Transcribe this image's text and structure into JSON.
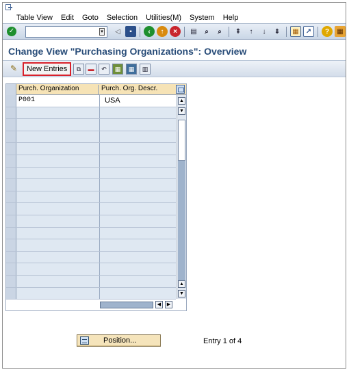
{
  "menu": {
    "items": [
      "Table View",
      "Edit",
      "Goto",
      "Selection",
      "Utilities(M)",
      "System",
      "Help"
    ]
  },
  "toolbar": {
    "command_value": "",
    "icons": [
      "enter-icon",
      "save-icon",
      "back-icon",
      "exit-icon",
      "cancel-icon",
      "print-icon",
      "find-icon",
      "find-next-icon",
      "first-page-icon",
      "previous-page-icon",
      "next-page-icon",
      "last-page-icon",
      "create-session-icon",
      "shortcut-icon",
      "help-icon",
      "layout-icon"
    ]
  },
  "page": {
    "title": "Change View \"Purchasing Organizations\": Overview"
  },
  "app_toolbar": {
    "new_entries_label": "New Entries",
    "icons": [
      "display-change-icon",
      "copy-icon",
      "delete-icon",
      "undo-icon",
      "select-all-icon",
      "select-block-icon",
      "deselect-all-icon"
    ]
  },
  "table": {
    "columns": [
      "Purch. Organization",
      "Purch. Org. Descr."
    ],
    "rows": [
      {
        "org": "P001",
        "descr": "USA"
      },
      {
        "org": "",
        "descr": ""
      },
      {
        "org": "",
        "descr": ""
      },
      {
        "org": "",
        "descr": ""
      },
      {
        "org": "",
        "descr": ""
      },
      {
        "org": "",
        "descr": ""
      },
      {
        "org": "",
        "descr": ""
      },
      {
        "org": "",
        "descr": ""
      },
      {
        "org": "",
        "descr": ""
      },
      {
        "org": "",
        "descr": ""
      },
      {
        "org": "",
        "descr": ""
      },
      {
        "org": "",
        "descr": ""
      },
      {
        "org": "",
        "descr": ""
      },
      {
        "org": "",
        "descr": ""
      },
      {
        "org": "",
        "descr": ""
      },
      {
        "org": "",
        "descr": ""
      },
      {
        "org": "",
        "descr": ""
      }
    ]
  },
  "footer": {
    "position_label": "Position...",
    "entry_text": "Entry 1 of 4"
  },
  "colors": {
    "title": "#284c78",
    "highlight": "#d9202a",
    "header": "#f6e3b6",
    "row": "#dfe8f2"
  }
}
